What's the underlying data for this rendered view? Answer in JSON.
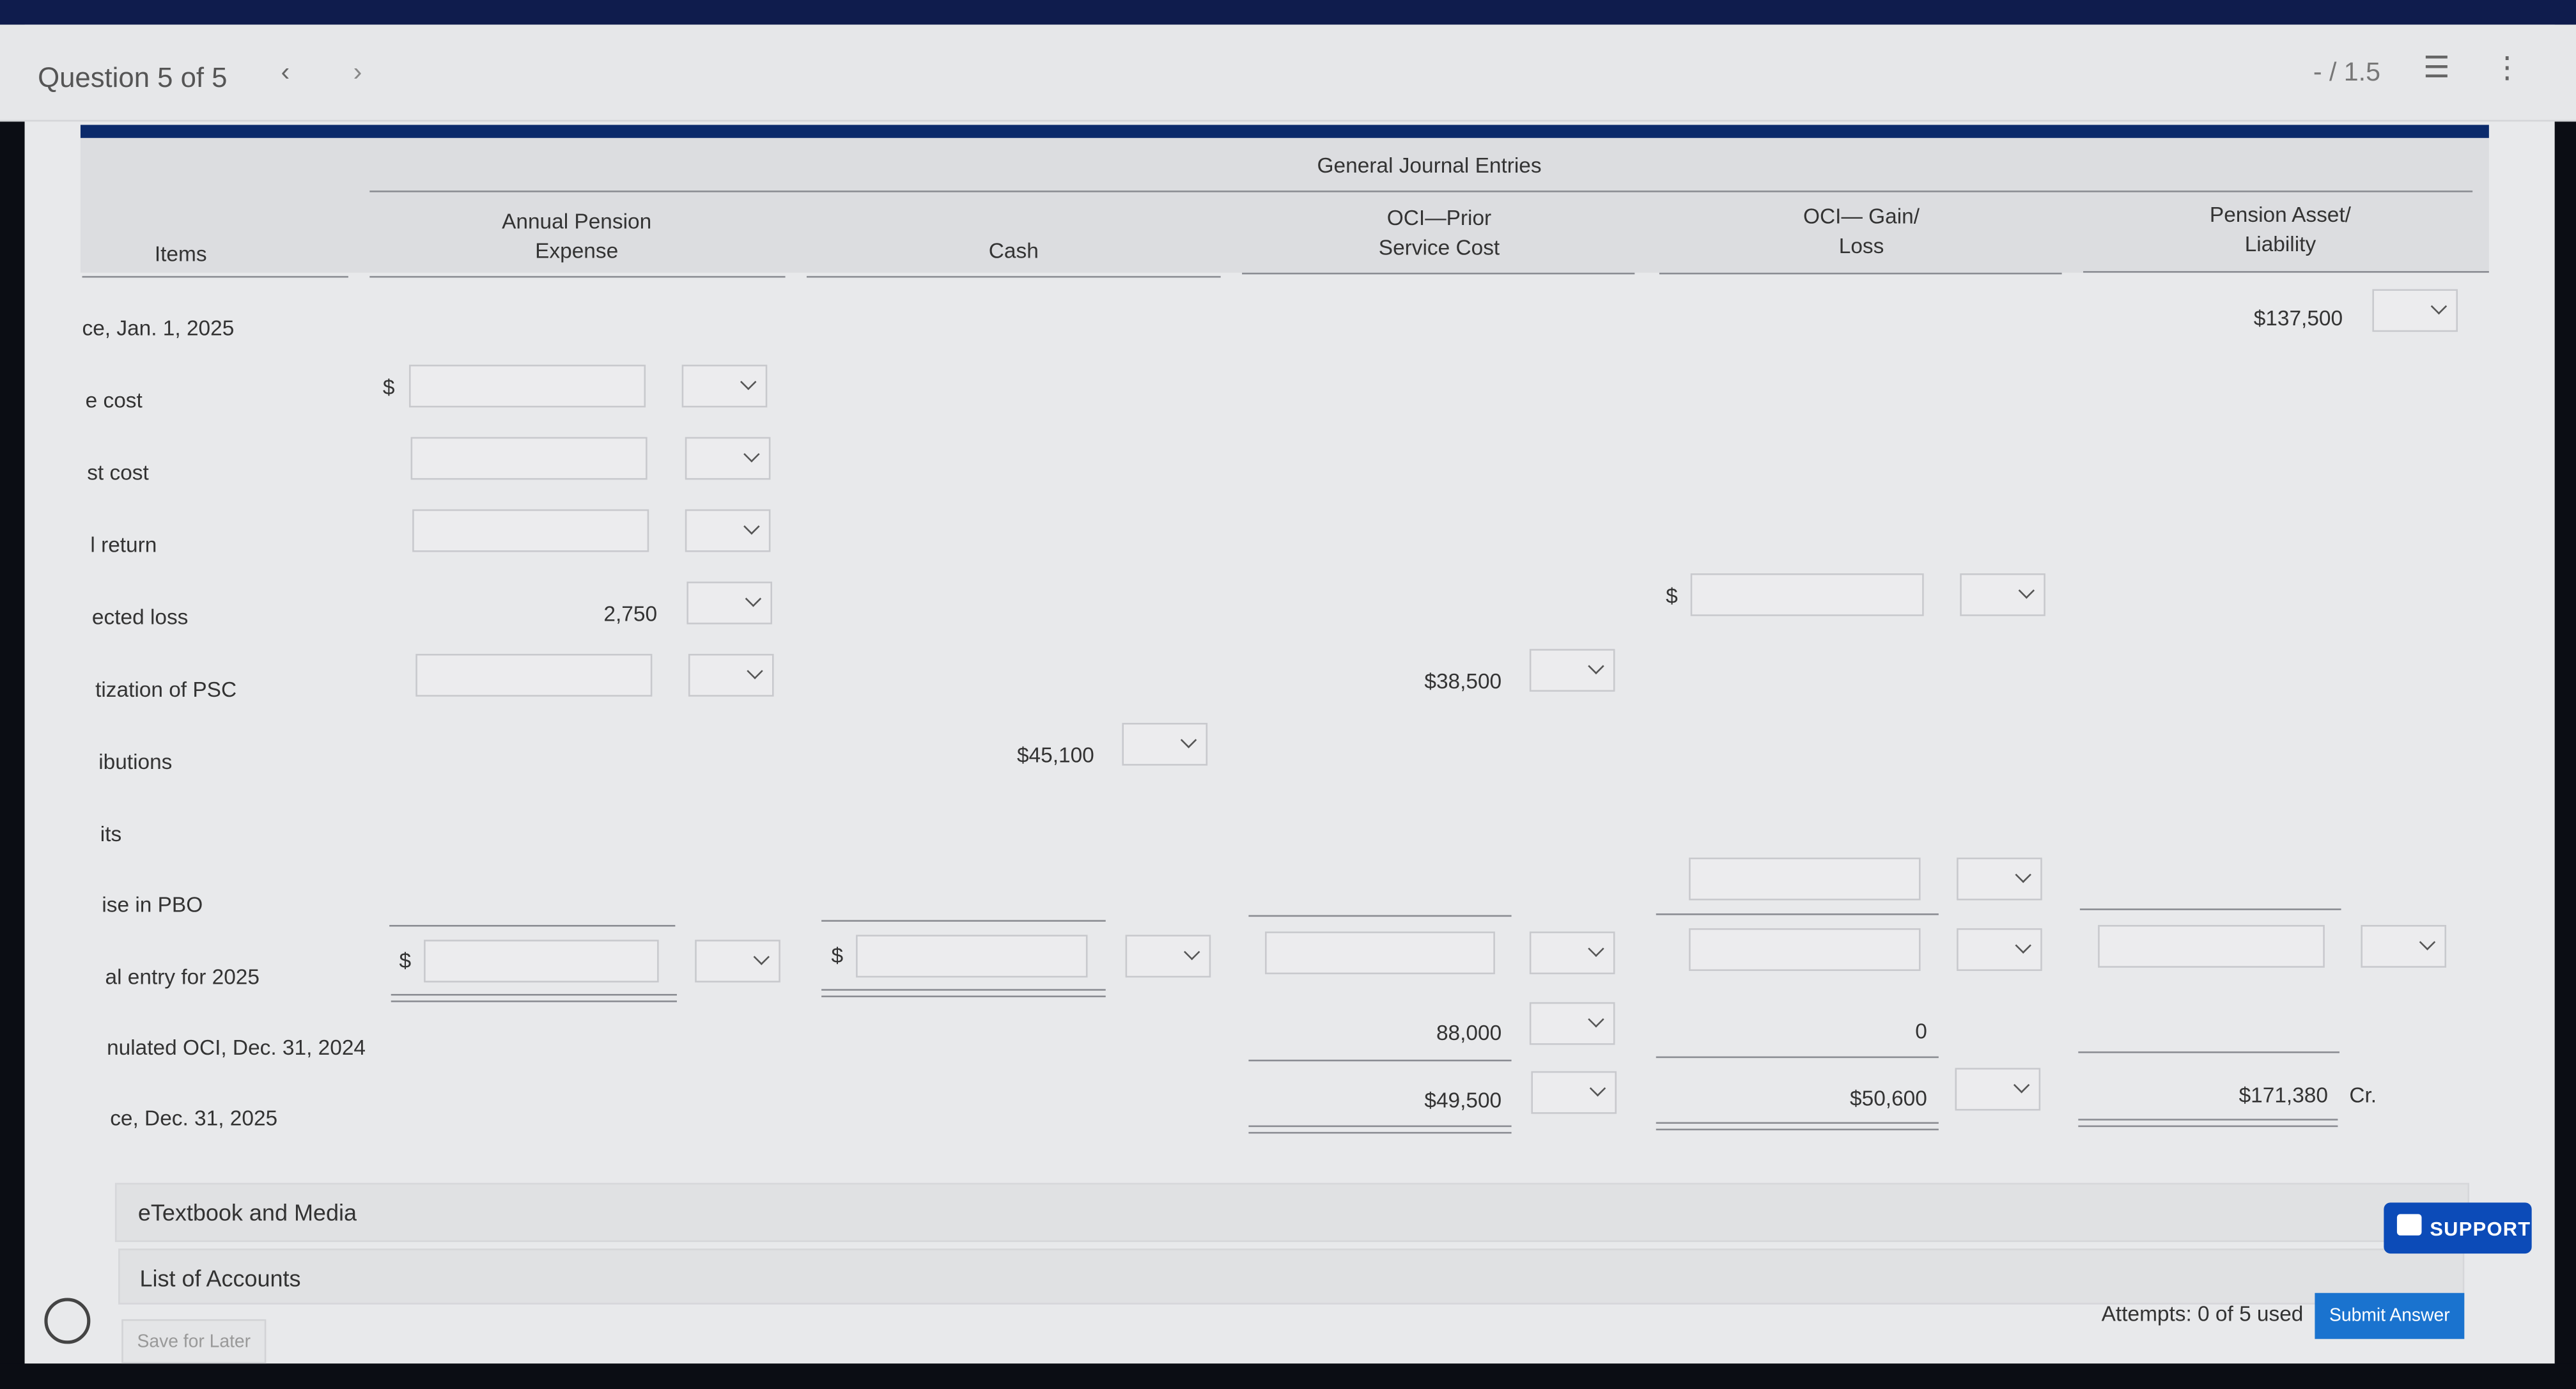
{
  "header": {
    "question_label": "Question 5 of 5",
    "prev_icon": "chevron-left-icon",
    "next_icon": "chevron-right-icon",
    "score": "- / 1.5",
    "list_icon": "list-icon",
    "more_icon": "more-vertical-icon"
  },
  "table": {
    "group_title": "General Journal Entries",
    "columns": {
      "items": "Items",
      "ape_1": "Annual Pension",
      "ape_2": "Expense",
      "cash": "Cash",
      "psc_1": "OCI—Prior",
      "psc_2": "Service Cost",
      "gl_1": "OCI— Gain/",
      "gl_2": "Loss",
      "pa_1": "Pension Asset/",
      "pa_2": "Liability"
    },
    "rows": [
      {
        "label": "ce, Jan. 1, 2025",
        "pension": "$137,500"
      },
      {
        "label": "e cost",
        "currency": "$"
      },
      {
        "label": "st cost"
      },
      {
        "label": "l return"
      },
      {
        "label": "ected loss",
        "ape": "2,750",
        "currency": "$"
      },
      {
        "label": "tization of PSC",
        "psc": "$38,500"
      },
      {
        "label": "ibutions",
        "cash": "$45,100"
      },
      {
        "label": "its"
      },
      {
        "label": "ise in PBO"
      },
      {
        "label": "al entry for 2025",
        "currency": "$"
      },
      {
        "label": "nulated OCI, Dec. 31, 2024",
        "psc": "88,000",
        "gl": "0"
      },
      {
        "label": "ce, Dec. 31, 2025",
        "psc": "$49,500",
        "gl": "$50,600",
        "pension": "$171,380",
        "pension_suffix": "Cr."
      }
    ]
  },
  "footer": {
    "etextbook": "eTextbook and Media",
    "accounts": "List of Accounts",
    "support": "SUPPORT",
    "save": "Save for Later",
    "attempts": "Attempts: 0 of 5 used",
    "submit": "Submit Answer"
  },
  "colors": {
    "brand": "#0b2a6b",
    "support": "#0c4bb8",
    "submit": "#1a73cf"
  }
}
